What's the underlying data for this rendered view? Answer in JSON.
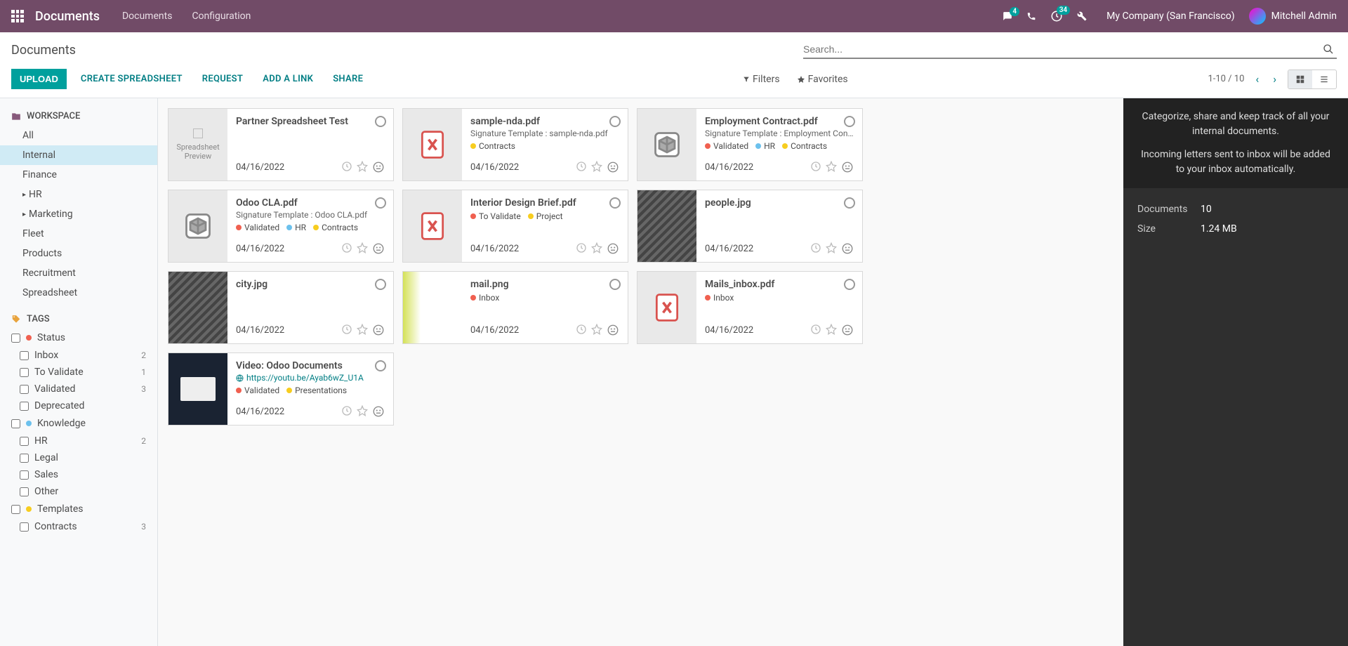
{
  "topnav": {
    "brand": "Documents",
    "links": [
      "Documents",
      "Configuration"
    ],
    "chat_badge": "4",
    "clock_badge": "34",
    "company": "My Company (San Francisco)",
    "user": "Mitchell Admin"
  },
  "controlbar": {
    "title": "Documents",
    "search_placeholder": "Search...",
    "upload": "UPLOAD",
    "create_spreadsheet": "CREATE SPREADSHEET",
    "request": "REQUEST",
    "add_link": "ADD A LINK",
    "share": "SHARE",
    "filters": "Filters",
    "favorites": "Favorites",
    "pager": "1-10 / 10"
  },
  "sidebar": {
    "workspace_label": "WORKSPACE",
    "workspaces": [
      {
        "label": "All",
        "expandable": false
      },
      {
        "label": "Internal",
        "expandable": false,
        "active": true
      },
      {
        "label": "Finance",
        "expandable": false
      },
      {
        "label": "HR",
        "expandable": true
      },
      {
        "label": "Marketing",
        "expandable": true
      },
      {
        "label": "Fleet",
        "expandable": false
      },
      {
        "label": "Products",
        "expandable": false
      },
      {
        "label": "Recruitment",
        "expandable": false
      },
      {
        "label": "Spreadsheet",
        "expandable": false
      }
    ],
    "tags_label": "TAGS",
    "tag_groups": [
      {
        "label": "Status",
        "color": "#f06050",
        "items": [
          {
            "label": "Inbox",
            "count": "2"
          },
          {
            "label": "To Validate",
            "count": "1"
          },
          {
            "label": "Validated",
            "count": "3"
          },
          {
            "label": "Deprecated",
            "count": ""
          }
        ]
      },
      {
        "label": "Knowledge",
        "color": "#6cc1ed",
        "items": [
          {
            "label": "HR",
            "count": "2"
          },
          {
            "label": "Legal",
            "count": ""
          },
          {
            "label": "Sales",
            "count": ""
          },
          {
            "label": "Other",
            "count": ""
          }
        ]
      },
      {
        "label": "Templates",
        "color": "#f7cd1f",
        "items": [
          {
            "label": "Contracts",
            "count": "3"
          }
        ]
      }
    ]
  },
  "cards": [
    {
      "name": "Partner Spreadsheet Test",
      "thumb": "spreadsheet",
      "thumb_text": "Spreadsheet Preview",
      "date": "04/16/2022"
    },
    {
      "name": "sample-nda.pdf",
      "thumb": "pdf",
      "sub_label": "Signature Template",
      "sub_value": "sample-nda.pdf",
      "tags": [
        {
          "color": "#f7cd1f",
          "label": "Contracts"
        }
      ],
      "date": "04/16/2022"
    },
    {
      "name": "Employment Contract.pdf",
      "thumb": "box",
      "sub_label": "Signature Template",
      "sub_value": "Employment Contr...",
      "tags": [
        {
          "color": "#f06050",
          "label": "Validated"
        },
        {
          "color": "#6cc1ed",
          "label": "HR"
        },
        {
          "color": "#f7cd1f",
          "label": "Contracts"
        }
      ],
      "date": "04/16/2022"
    },
    {
      "name": "Odoo CLA.pdf",
      "thumb": "box",
      "sub_label": "Signature Template",
      "sub_value": "Odoo CLA.pdf",
      "tags": [
        {
          "color": "#f06050",
          "label": "Validated"
        },
        {
          "color": "#6cc1ed",
          "label": "HR"
        },
        {
          "color": "#f7cd1f",
          "label": "Contracts"
        }
      ],
      "date": "04/16/2022"
    },
    {
      "name": "Interior Design Brief.pdf",
      "thumb": "pdf",
      "tags": [
        {
          "color": "#f06050",
          "label": "To Validate"
        },
        {
          "color": "#f7cd1f",
          "label": "Project"
        }
      ],
      "date": "04/16/2022"
    },
    {
      "name": "people.jpg",
      "thumb": "img",
      "date": "04/16/2022"
    },
    {
      "name": "city.jpg",
      "thumb": "img",
      "date": "04/16/2022"
    },
    {
      "name": "mail.png",
      "thumb": "img-light",
      "tags": [
        {
          "color": "#f06050",
          "label": "Inbox"
        }
      ],
      "date": "04/16/2022"
    },
    {
      "name": "Mails_inbox.pdf",
      "thumb": "pdf",
      "tags": [
        {
          "color": "#f06050",
          "label": "Inbox"
        }
      ],
      "date": "04/16/2022"
    },
    {
      "name": "Video: Odoo Documents",
      "thumb": "video",
      "link": "https://youtu.be/Ayab6wZ_U1A",
      "tags": [
        {
          "color": "#f06050",
          "label": "Validated"
        },
        {
          "color": "#f7cd1f",
          "label": "Presentations"
        }
      ],
      "date": "04/16/2022"
    }
  ],
  "infopanel": {
    "msg1": "Categorize, share and keep track of all your internal documents.",
    "msg2": "Incoming letters sent to inbox will be added to your inbox automatically.",
    "stats": [
      {
        "label": "Documents",
        "value": "10"
      },
      {
        "label": "Size",
        "value": "1.24 MB"
      }
    ]
  }
}
